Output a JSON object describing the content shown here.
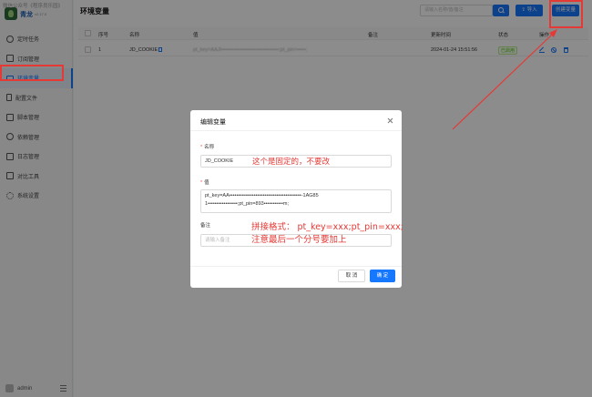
{
  "watermark": "微信公众号《程序员乐园》",
  "app": {
    "brand": "青龙",
    "version": "v2.17.0"
  },
  "sidebar": {
    "items": [
      {
        "label": "定时任务",
        "icon": "clock-icon"
      },
      {
        "label": "订阅管理",
        "icon": "subscription-icon"
      },
      {
        "label": "环境变量",
        "icon": "env-icon",
        "active": true
      },
      {
        "label": "配置文件",
        "icon": "file-icon"
      },
      {
        "label": "脚本管理",
        "icon": "script-icon"
      },
      {
        "label": "依赖管理",
        "icon": "dependency-icon"
      },
      {
        "label": "日志管理",
        "icon": "log-icon"
      },
      {
        "label": "对比工具",
        "icon": "diff-icon"
      },
      {
        "label": "系统设置",
        "icon": "gear-icon"
      }
    ],
    "user": "admin"
  },
  "header": {
    "title": "环境变量",
    "search_placeholder": "请输入名称/值/备注",
    "import_label": "导入",
    "create_label": "创建变量"
  },
  "table": {
    "columns": [
      "序号",
      "名称",
      "值",
      "备注",
      "更新时间",
      "状态",
      "操作"
    ],
    "rows": [
      {
        "index": "1",
        "name": "JD_COOKIE",
        "value": "pt_key=AAJl•••••••••••••••••••••••••••••••••;pt_pin=•••••;",
        "remark": "",
        "updated": "2024-01-24 15:51:56",
        "status": "已启用"
      }
    ]
  },
  "modal": {
    "title": "编辑变量",
    "name_label": "名称",
    "name_value": "JD_COOKIE",
    "value_label": "值",
    "value_line1": "pt_key=AA•••••••••••••••••••••••••••••••••••••••••-1AG85",
    "value_line2": "1•••••••••••••••••;pt_pin=893•••••••••••m;",
    "remark_label": "备注",
    "remark_placeholder": "请输入备注",
    "cancel_label": "取 消",
    "ok_label": "确 定"
  },
  "annotations": {
    "name_note": "这个是固定的，不要改",
    "format_line1": "拼接格式： pt_key=xxx;pt_pin=xxx;",
    "format_line2": "注意最后一个分号要加上"
  },
  "colors": {
    "primary": "#1677ff",
    "annotation": "#e53935",
    "success": "#52c41a"
  }
}
